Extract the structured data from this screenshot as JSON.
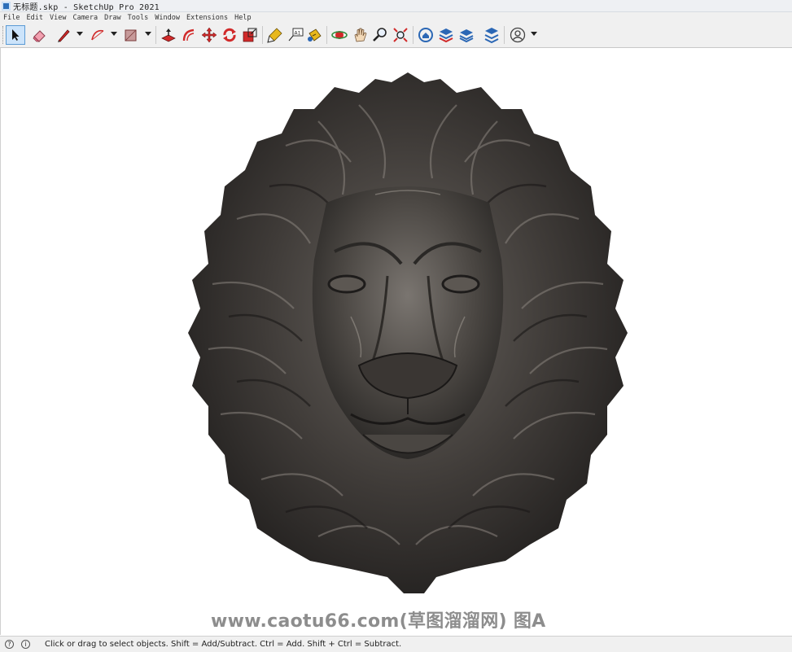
{
  "window": {
    "title": "无标题.skp - SketchUp Pro 2021"
  },
  "menu": [
    "File",
    "Edit",
    "View",
    "Camera",
    "Draw",
    "Tools",
    "Window",
    "Extensions",
    "Help"
  ],
  "toolbar": {
    "tools": [
      {
        "name": "select",
        "icon": "select-arrow-icon",
        "active": true
      },
      {
        "name": "eraser",
        "icon": "eraser-icon"
      },
      {
        "name": "line",
        "icon": "pencil-icon",
        "dropdown": true
      },
      {
        "name": "arc",
        "icon": "arc-icon",
        "dropdown": true
      },
      {
        "name": "rectangle",
        "icon": "rectangle-icon",
        "dropdown": true
      },
      {
        "name": "push-pull",
        "icon": "push-pull-icon"
      },
      {
        "name": "offset",
        "icon": "offset-icon"
      },
      {
        "name": "move",
        "icon": "move-icon"
      },
      {
        "name": "rotate",
        "icon": "rotate-icon"
      },
      {
        "name": "scale",
        "icon": "scale-icon"
      },
      {
        "name": "tape-measure",
        "icon": "tape-measure-icon"
      },
      {
        "name": "text",
        "icon": "text-icon"
      },
      {
        "name": "paint-bucket",
        "icon": "paint-bucket-icon"
      },
      {
        "name": "orbit",
        "icon": "orbit-icon"
      },
      {
        "name": "pan",
        "icon": "pan-icon"
      },
      {
        "name": "zoom",
        "icon": "zoom-icon"
      },
      {
        "name": "zoom-extents",
        "icon": "zoom-extents-icon"
      },
      {
        "name": "warehouse",
        "icon": "warehouse-icon"
      },
      {
        "name": "extension-warehouse",
        "icon": "extension-warehouse-icon"
      },
      {
        "name": "layout",
        "icon": "layout-icon"
      },
      {
        "name": "extension-manager",
        "icon": "extension-manager-icon"
      },
      {
        "name": "account",
        "icon": "account-icon",
        "dropdown": true
      }
    ],
    "colors": {
      "red": "#d12a2a",
      "blue": "#2b67b5",
      "yellow": "#e8b81d",
      "pink": "#e46a88"
    }
  },
  "viewport": {
    "watermark": "www.caotu66.com(草图溜溜网) 图A"
  },
  "status": {
    "text": "Click or drag to select objects. Shift = Add/Subtract. Ctrl = Add. Shift + Ctrl = Subtract."
  }
}
